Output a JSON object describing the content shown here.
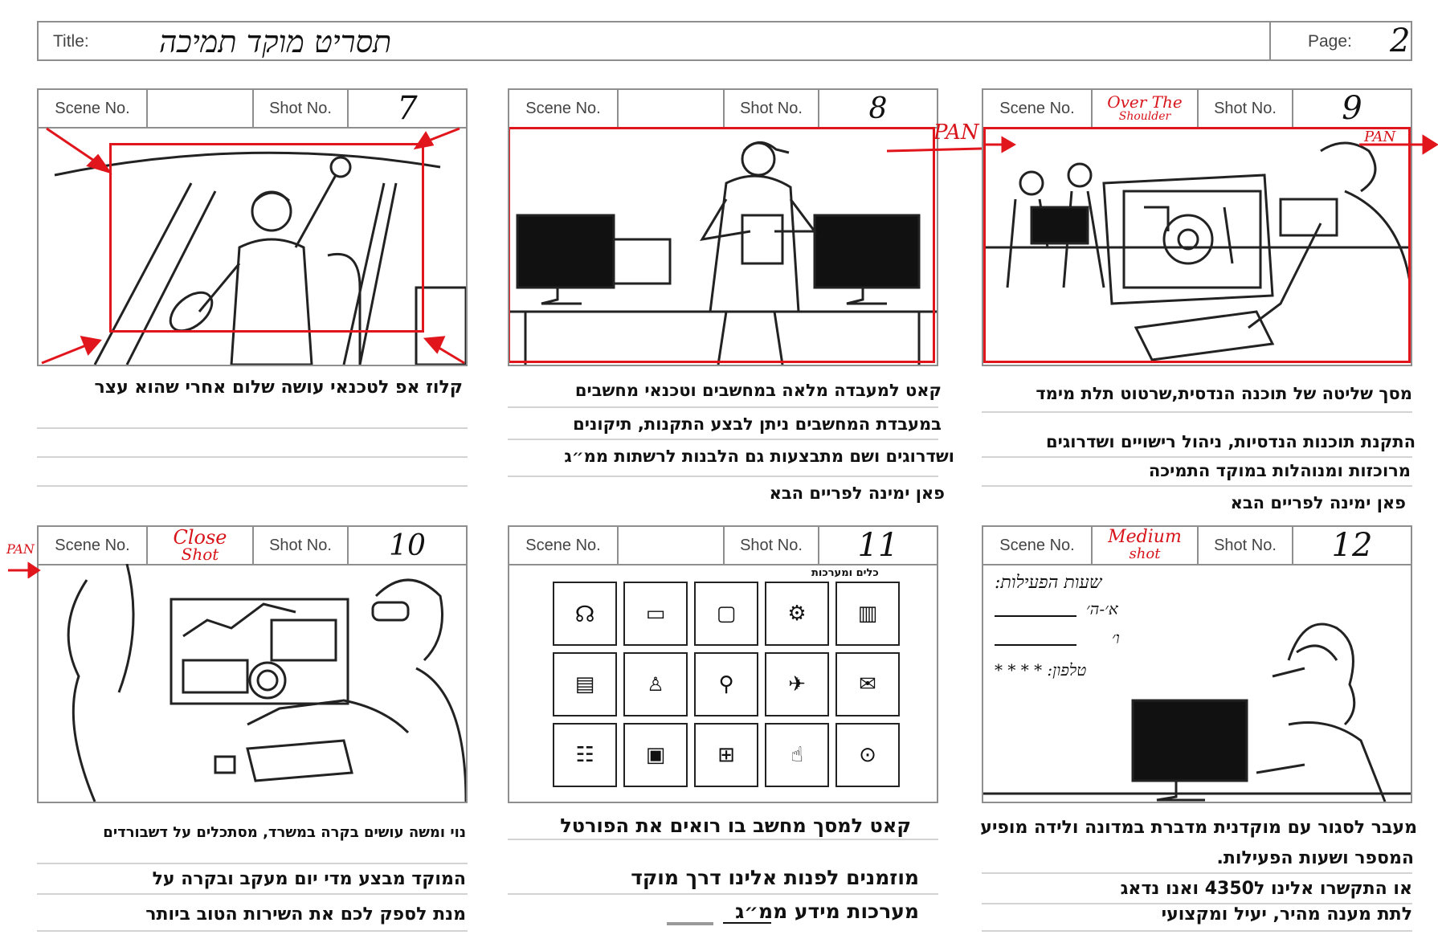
{
  "title_bar": {
    "title_label": "Title:",
    "title_value": "תסריט מוקד תמיכה",
    "page_label": "Page:",
    "page_value": "2"
  },
  "labels": {
    "scene": "Scene No.",
    "shot": "Shot No."
  },
  "panels": [
    {
      "shot": "7",
      "scene_note": "",
      "caption": [
        "קלוז אפ לטכנאי עושה שלום אחרי שהוא עצר"
      ]
    },
    {
      "shot": "8",
      "scene_note": "",
      "pan": "PAN",
      "caption": [
        "קאט למעבדה מלאה במחשבים  וטכנאי מחשבים",
        "במעבדת המחשבים ניתן לבצע התקנות, תיקונים",
        "ושדרוגים ושם מתבצעות גם הלבנות לרשתות ממ״ג",
        "פאן ימינה לפריים הבא"
      ]
    },
    {
      "shot": "9",
      "scene_note_1": "Over The",
      "scene_note_2": "Shoulder",
      "pan": "PAN",
      "caption": [
        "מסך שליטה של תוכנה הנדסית,שרטוט תלת מימד",
        "התקנת תוכנות הנדסיות, ניהול רישויים ושדרוגים",
        "מרוכזות ומנוהלות במוקד התמיכה",
        "פאן ימינה לפריים הבא"
      ]
    },
    {
      "shot": "10",
      "scene_note_1": "Close",
      "scene_note_2": "Shot",
      "pan": "PAN",
      "caption": [
        "נוי ומשה עושים בקרה במשרד, מסתכלים על דשבורדים",
        "המוקד מבצע מדי יום מעקב ובקרה על",
        "מנת  לספק לכם את השירות הטוב ביותר"
      ]
    },
    {
      "shot": "11",
      "scene_note": "",
      "grid_title": "כלים ומערכות",
      "caption": [
        "קאט למסך מחשב בו רואים את הפורטל",
        "מוזמנים לפנות אלינו דרך מוקד",
        "מערכות מידע ממ״ג"
      ]
    },
    {
      "shot": "12",
      "scene_note_1": "Medium",
      "scene_note_2": "shot",
      "note_title": "שעות הפעילות:",
      "note_lines": [
        "א׳-ה׳",
        "ו׳",
        "טלפון: * * * *"
      ],
      "caption": [
        "מעבר לסגור עם מוקדנית מדברת במדונה ולידה מופיע",
        "המספר ושעות הפעילות.",
        "או התקשרו אלינו ל4350 ואנו נדאג",
        "לתת מענה מהיר, יעיל ומקצועי"
      ]
    }
  ],
  "colors": {
    "annotation_red": "#e1161c",
    "grid_gray": "#8e8e8e"
  }
}
